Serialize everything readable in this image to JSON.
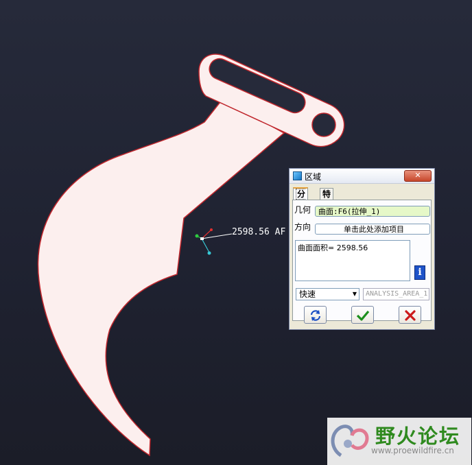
{
  "viewport": {
    "measurement_readout": "2598.56 AF",
    "colors": {
      "background": "#232634",
      "part_fill": "#fcefee",
      "part_edge": "#c0272d"
    }
  },
  "dialog": {
    "title": "区域",
    "close_glyph": "✕",
    "tabs": [
      {
        "label": "分析"
      },
      {
        "label": "特征"
      }
    ],
    "geometry_label": "几何",
    "geometry_value": "曲面:F6(拉伸_1)",
    "direction_label": "方向",
    "direction_placeholder": "单击此处添加项目",
    "result_text": "曲面面积= 2598.56",
    "info_glyph": "i",
    "mode_select": "快速",
    "analysis_name": "ANALYSIS_AREA_1",
    "buttons": {
      "repeat_icon": "repeat-icon",
      "ok_icon": "checkmark-icon",
      "cancel_icon": "cross-icon"
    }
  },
  "watermark": {
    "title": "野火论坛",
    "url": "www.proewildfire.cn"
  }
}
